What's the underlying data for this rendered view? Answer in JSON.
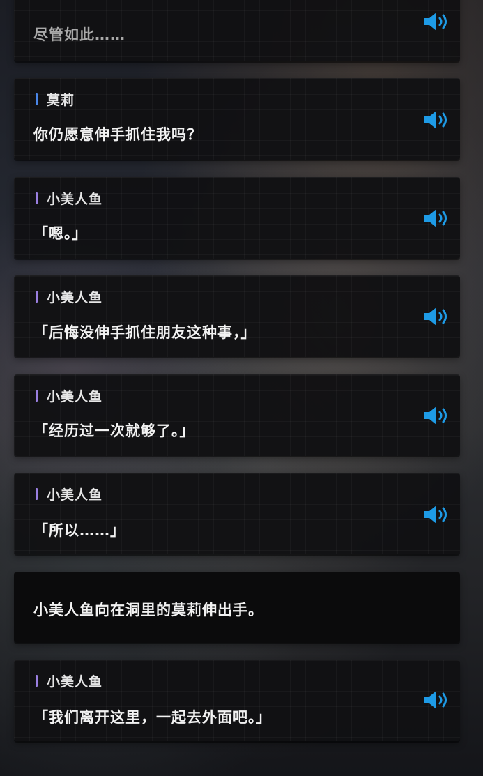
{
  "colors": {
    "voice_icon": "#1e9be6",
    "speaker_bar_molly": "#4a86e8",
    "speaker_bar_mermaid": "#9a7fe0",
    "text": "#f2f2f2"
  },
  "entries": [
    {
      "type": "dialogue",
      "speaker": "",
      "text": "尽管如此……"
    },
    {
      "type": "dialogue",
      "speaker": "莫莉",
      "text": "你仍愿意伸手抓住我吗？"
    },
    {
      "type": "dialogue",
      "speaker": "小美人鱼",
      "text": "「嗯。」"
    },
    {
      "type": "dialogue",
      "speaker": "小美人鱼",
      "text": "「后悔没伸手抓住朋友这种事，」"
    },
    {
      "type": "dialogue",
      "speaker": "小美人鱼",
      "text": "「经历过一次就够了。」"
    },
    {
      "type": "dialogue",
      "speaker": "小美人鱼",
      "text": "「所以……」"
    },
    {
      "type": "narration",
      "speaker": "",
      "text": "小美人鱼向在洞里的莫莉伸出手。"
    },
    {
      "type": "dialogue",
      "speaker": "小美人鱼",
      "text": "「我们离开这里，一起去外面吧。」"
    }
  ],
  "icons": {
    "voice": "speaker-volume-icon"
  }
}
